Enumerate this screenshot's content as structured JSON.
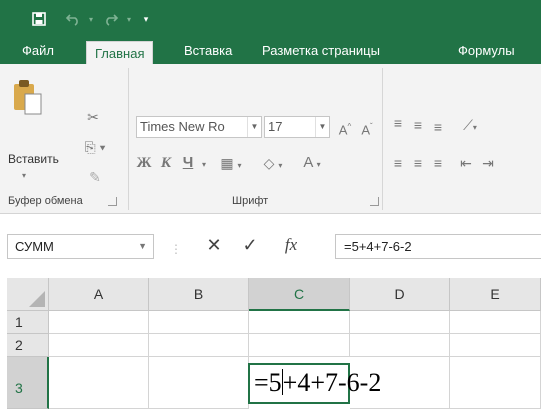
{
  "quick_access": {
    "save_icon": "save-icon",
    "undo_icon": "undo-icon",
    "redo_icon": "redo-icon",
    "customize_icon": "customize-qat-icon"
  },
  "tabs": [
    "Файл",
    "Главная",
    "Вставка",
    "Разметка страницы",
    "Формулы"
  ],
  "ribbon": {
    "clipboard": {
      "paste_label": "Вставить",
      "group_label": "Буфер обмена"
    },
    "font": {
      "font_name": "Times New Ro",
      "font_size": "17",
      "bold": "Ж",
      "italic": "К",
      "underline": "Ч",
      "group_label": "Шрифт"
    }
  },
  "formula_bar": {
    "name_box": "СУММ",
    "fx_label": "fx",
    "formula": "=5+4+7-6-2"
  },
  "grid": {
    "columns": [
      "A",
      "B",
      "C",
      "D",
      "E"
    ],
    "rows": [
      "1",
      "2",
      "3"
    ],
    "active_cell_text_before_caret": "=5",
    "active_cell_text_after_caret": "+4+7-6-2"
  },
  "colors": {
    "accent": "#217346",
    "ribbon_bg": "#f3f3f3"
  }
}
